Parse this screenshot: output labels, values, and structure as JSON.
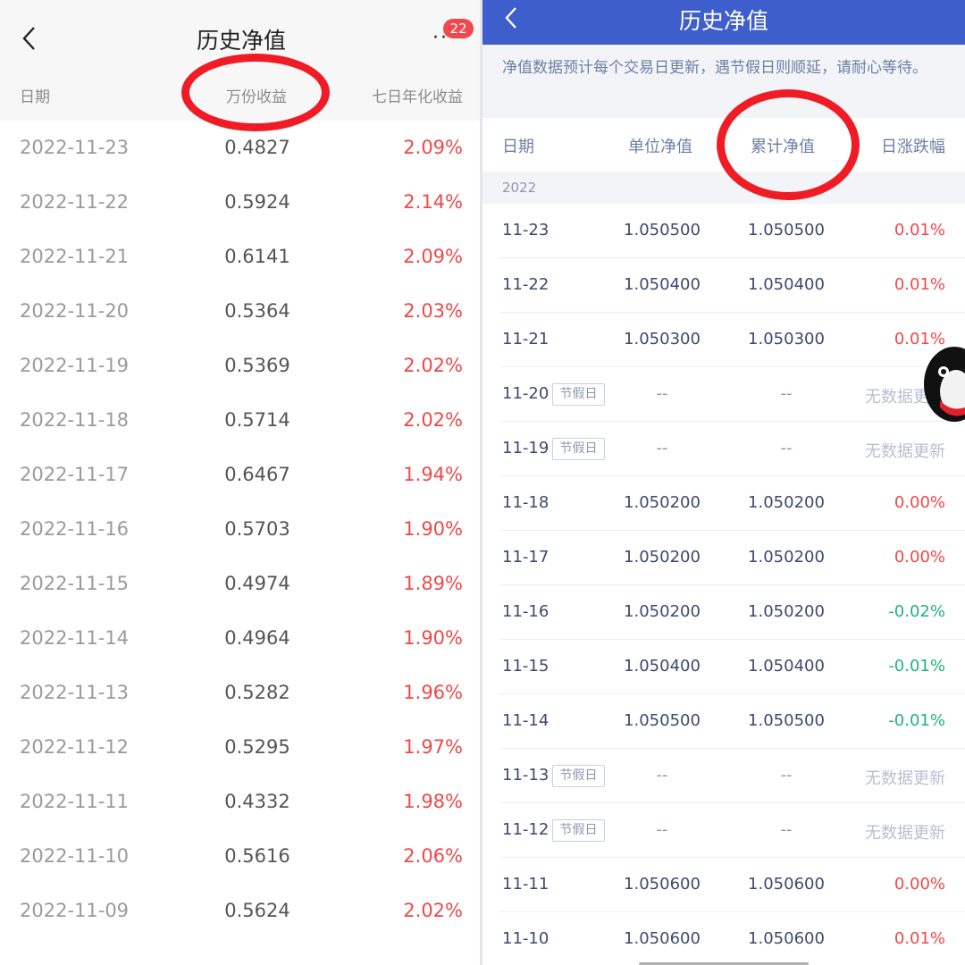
{
  "left": {
    "title": "历史净值",
    "badge": "22",
    "more_label": "···",
    "headers": {
      "date": "日期",
      "value": "万份收益",
      "rate": "七日年化收益"
    },
    "rows": [
      {
        "date": "2022-11-23",
        "value": "0.4827",
        "rate": "2.09%"
      },
      {
        "date": "2022-11-22",
        "value": "0.5924",
        "rate": "2.14%"
      },
      {
        "date": "2022-11-21",
        "value": "0.6141",
        "rate": "2.09%"
      },
      {
        "date": "2022-11-20",
        "value": "0.5364",
        "rate": "2.03%"
      },
      {
        "date": "2022-11-19",
        "value": "0.5369",
        "rate": "2.02%"
      },
      {
        "date": "2022-11-18",
        "value": "0.5714",
        "rate": "2.02%"
      },
      {
        "date": "2022-11-17",
        "value": "0.6467",
        "rate": "1.94%"
      },
      {
        "date": "2022-11-16",
        "value": "0.5703",
        "rate": "1.90%"
      },
      {
        "date": "2022-11-15",
        "value": "0.4974",
        "rate": "1.89%"
      },
      {
        "date": "2022-11-14",
        "value": "0.4964",
        "rate": "1.90%"
      },
      {
        "date": "2022-11-13",
        "value": "0.5282",
        "rate": "1.96%"
      },
      {
        "date": "2022-11-12",
        "value": "0.5295",
        "rate": "1.97%"
      },
      {
        "date": "2022-11-11",
        "value": "0.4332",
        "rate": "1.98%"
      },
      {
        "date": "2022-11-10",
        "value": "0.5616",
        "rate": "2.06%"
      },
      {
        "date": "2022-11-09",
        "value": "0.5624",
        "rate": "2.02%"
      }
    ]
  },
  "right": {
    "title": "历史净值",
    "notice": "净值数据预计每个交易日更新，遇节假日则顺延，请耐心等待。",
    "headers": {
      "date": "日期",
      "unit": "单位净值",
      "cum": "累计净值",
      "change": "日涨跌幅"
    },
    "year": "2022",
    "rows": [
      {
        "date": "11-23",
        "tag": "",
        "unit": "1.050500",
        "cum": "1.050500",
        "change": "0.01%",
        "kind": "up"
      },
      {
        "date": "11-22",
        "tag": "",
        "unit": "1.050400",
        "cum": "1.050400",
        "change": "0.01%",
        "kind": "up"
      },
      {
        "date": "11-21",
        "tag": "",
        "unit": "1.050300",
        "cum": "1.050300",
        "change": "0.01%",
        "kind": "up"
      },
      {
        "date": "11-20",
        "tag": "节假日",
        "unit": "--",
        "cum": "--",
        "change": "无数据更新",
        "kind": "none"
      },
      {
        "date": "11-19",
        "tag": "节假日",
        "unit": "--",
        "cum": "--",
        "change": "无数据更新",
        "kind": "none"
      },
      {
        "date": "11-18",
        "tag": "",
        "unit": "1.050200",
        "cum": "1.050200",
        "change": "0.00%",
        "kind": "up"
      },
      {
        "date": "11-17",
        "tag": "",
        "unit": "1.050200",
        "cum": "1.050200",
        "change": "0.00%",
        "kind": "up"
      },
      {
        "date": "11-16",
        "tag": "",
        "unit": "1.050200",
        "cum": "1.050200",
        "change": "-0.02%",
        "kind": "down"
      },
      {
        "date": "11-15",
        "tag": "",
        "unit": "1.050400",
        "cum": "1.050400",
        "change": "-0.01%",
        "kind": "down"
      },
      {
        "date": "11-14",
        "tag": "",
        "unit": "1.050500",
        "cum": "1.050500",
        "change": "-0.01%",
        "kind": "down"
      },
      {
        "date": "11-13",
        "tag": "节假日",
        "unit": "--",
        "cum": "--",
        "change": "无数据更新",
        "kind": "none"
      },
      {
        "date": "11-12",
        "tag": "节假日",
        "unit": "--",
        "cum": "--",
        "change": "无数据更新",
        "kind": "none"
      },
      {
        "date": "11-11",
        "tag": "",
        "unit": "1.050600",
        "cum": "1.050600",
        "change": "0.00%",
        "kind": "up"
      },
      {
        "date": "11-10",
        "tag": "",
        "unit": "1.050600",
        "cum": "1.050600",
        "change": "0.01%",
        "kind": "up"
      }
    ]
  },
  "colors": {
    "up": "#f04848",
    "down": "#20b27e",
    "nodata": "#b7bfcf",
    "right_nav": "#3d5ecb",
    "highlight_circle": "#ef1c25"
  }
}
